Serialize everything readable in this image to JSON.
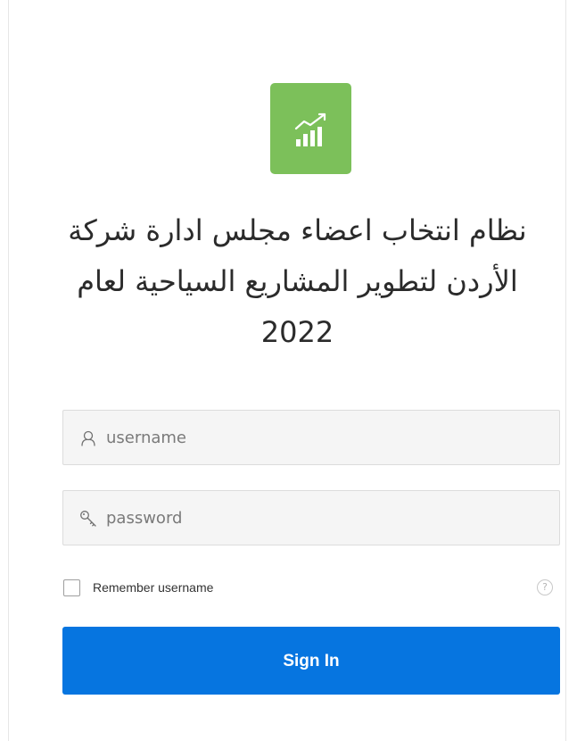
{
  "app": {
    "icon": "chart-growth-icon",
    "accent_color": "#7cc05a"
  },
  "header": {
    "title_line1": "نظام انتخاب اعضاء مجلس ادارة شركة",
    "title_line2": "الأردن لتطوير المشاريع السياحية لعام",
    "title_year": "2022"
  },
  "form": {
    "username": {
      "icon": "user-icon",
      "value": "",
      "placeholder": "username"
    },
    "password": {
      "icon": "key-icon",
      "value": "",
      "placeholder": "password"
    },
    "remember": {
      "label": "Remember username",
      "checked": false
    },
    "help_icon": "help-circle-icon",
    "help_glyph": "?",
    "submit_label": "Sign In",
    "submit_color": "#0675e0"
  }
}
